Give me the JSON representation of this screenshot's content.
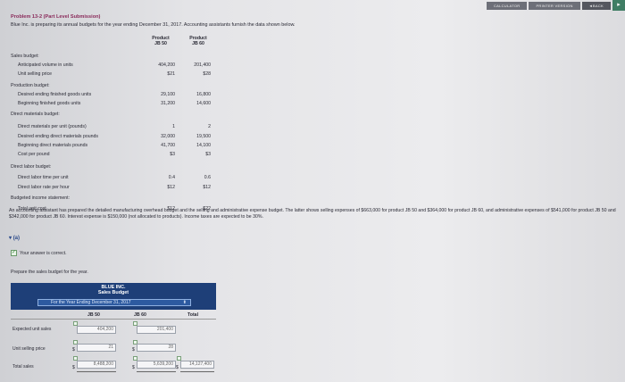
{
  "topbar": {
    "calculator": "CALCULATOR",
    "printer": "PRINTER VERSION",
    "back": "◄BACK",
    "corner": "▸"
  },
  "header": {
    "title": "Problem 13-2 (Part Level Submission)",
    "intro": "Blue Inc. is preparing its annual budgets for the year ending December 31, 2017. Accounting assistants furnish the data shown below."
  },
  "columns": {
    "p1": "Product\nJB 50",
    "p2": "Product\nJB 60"
  },
  "data_rows": [
    {
      "label": "Sales budget:",
      "indent": 0,
      "v1": "",
      "v2": ""
    },
    {
      "label": "Anticipated volume in units",
      "indent": 1,
      "v1": "404,200",
      "v2": "201,400"
    },
    {
      "label": "Unit selling price",
      "indent": 1,
      "v1": "$21",
      "v2": "$28"
    },
    {
      "label": "Production budget:",
      "indent": 0,
      "v1": "",
      "v2": ""
    },
    {
      "label": "Desired ending finished goods units",
      "indent": 1,
      "v1": "29,100",
      "v2": "16,800"
    },
    {
      "label": "Beginning finished goods units",
      "indent": 1,
      "v1": "31,200",
      "v2": "14,600"
    },
    {
      "label": "Direct materials budget:",
      "indent": 0,
      "v1": "",
      "v2": ""
    },
    {
      "label": "Direct materials per unit (pounds)",
      "indent": 1,
      "v1": "1",
      "v2": "2"
    },
    {
      "label": "Desired ending direct materials pounds",
      "indent": 1,
      "v1": "32,000",
      "v2": "19,500"
    },
    {
      "label": "Beginning direct materials pounds",
      "indent": 1,
      "v1": "41,700",
      "v2": "14,100"
    },
    {
      "label": "Cost per pound",
      "indent": 1,
      "v1": "$3",
      "v2": "$3"
    },
    {
      "label": "Direct labor budget:",
      "indent": 0,
      "v1": "",
      "v2": ""
    },
    {
      "label": "Direct labor time per unit",
      "indent": 1,
      "v1": "0.4",
      "v2": "0.6"
    },
    {
      "label": "Direct labor rate per hour",
      "indent": 1,
      "v1": "$12",
      "v2": "$12"
    },
    {
      "label": "Budgeted income statement:",
      "indent": 0,
      "v1": "",
      "v2": ""
    },
    {
      "label": "Total unit cost",
      "indent": 1,
      "v1": "$12",
      "v2": "$22"
    }
  ],
  "paragraph": "An accounting assistant has prepared the detailed manufacturing overhead budget and the selling and administrative expense budget. The latter shows selling expenses of $663,000 for product JB 50 and $364,000 for product JB 60, and administrative expenses of $541,000 for product JB 50 and $342,000 for product JB 60. Interest expense is $150,000 (not allocated to products). Income taxes are expected to be 30%.",
  "part": {
    "label": "(a)",
    "icon": "▾"
  },
  "feedback": {
    "text": "Your answer is correct.",
    "check": "✓"
  },
  "prompt": "Prepare the sales budget for the year.",
  "budget": {
    "company": "BLUE INC.",
    "name": "Sales Budget",
    "period": "For the Year Ending December 31, 2017",
    "period_caret": "⬍",
    "headers": {
      "c1": "JB 50",
      "c2": "JB 60",
      "c3": "Total"
    },
    "rows": [
      {
        "label": "Expected unit sales",
        "c1": "404,200",
        "c2": "201,400",
        "c3": ""
      },
      {
        "label": "Unit selling price",
        "c1": "21",
        "c2": "28",
        "c3": ""
      },
      {
        "label": "Total sales",
        "c1": "8,488,200",
        "c2": "5,639,200",
        "c3": "14,127,400"
      }
    ],
    "currency": "$"
  }
}
